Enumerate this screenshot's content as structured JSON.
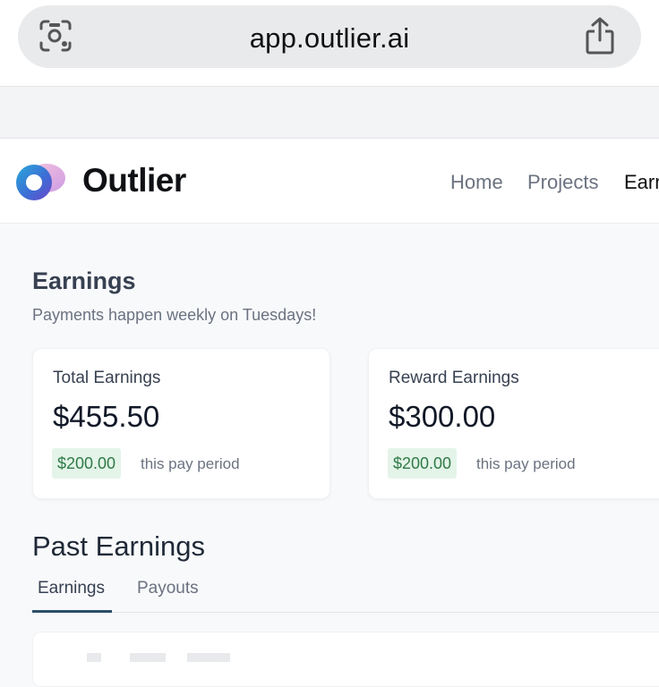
{
  "browser": {
    "url": "app.outlier.ai"
  },
  "header": {
    "brand": "Outlier",
    "nav": [
      {
        "label": "Home"
      },
      {
        "label": "Projects"
      },
      {
        "label": "Earn"
      }
    ]
  },
  "main": {
    "title": "Earnings",
    "subtitle": "Payments happen weekly on Tuesdays!",
    "cards": [
      {
        "label": "Total Earnings",
        "value": "$455.50",
        "badge": "$200.00",
        "period": "this pay period"
      },
      {
        "label": "Reward Earnings",
        "value": "$300.00",
        "badge": "$200.00",
        "period": "this pay period"
      }
    ],
    "past": {
      "title": "Past Earnings",
      "tabs": [
        {
          "label": "Earnings",
          "active": true
        },
        {
          "label": "Payouts",
          "active": false
        }
      ]
    }
  },
  "icons": {
    "lens": "lens-icon",
    "share": "share-icon",
    "logo": "outlier-logo-icon"
  },
  "colors": {
    "accent_tab": "#2b4f6b",
    "badge_bg": "#e4f4e9",
    "badge_text": "#2f7a46"
  }
}
